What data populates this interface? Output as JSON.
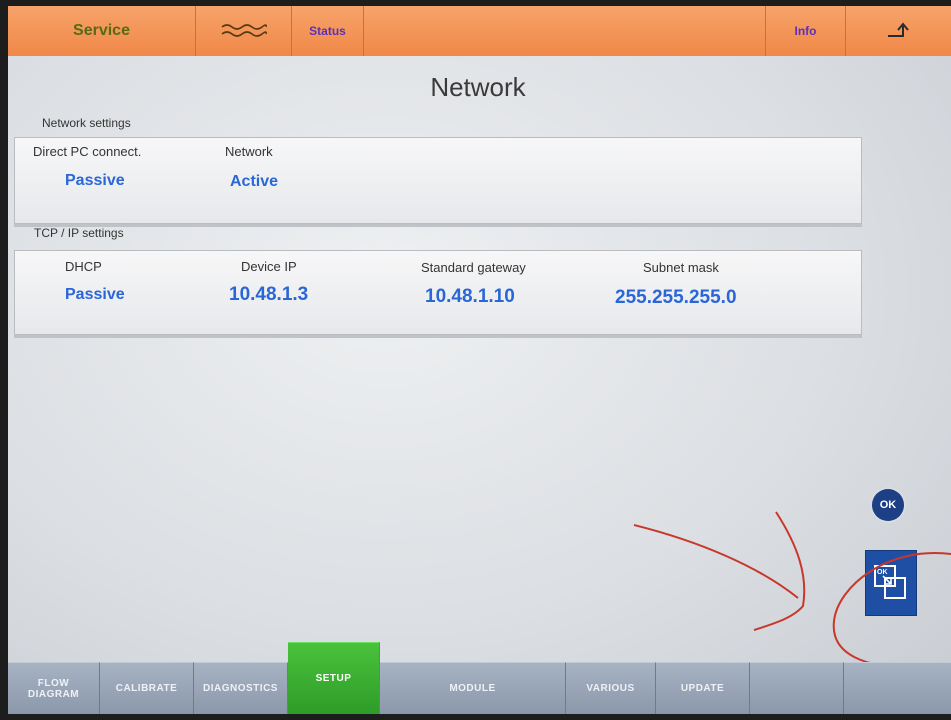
{
  "header": {
    "service_label": "Service",
    "status_label": "Status",
    "info_label": "Info",
    "waves_icon": "waves-icon",
    "back_icon": "return-arrow-icon"
  },
  "page": {
    "title": "Network"
  },
  "network_settings": {
    "section_label": "Network settings",
    "direct_pc": {
      "label": "Direct PC connect.",
      "value": "Passive"
    },
    "network": {
      "label": "Network",
      "value": "Active"
    }
  },
  "tcp_settings": {
    "section_label": "TCP / IP settings",
    "dhcp": {
      "label": "DHCP",
      "value": "Passive"
    },
    "device_ip": {
      "label": "Device IP",
      "value": "10.48.1.3"
    },
    "gateway": {
      "label": "Standard gateway",
      "value": "10.48.1.10"
    },
    "subnet": {
      "label": "Subnet mask",
      "value": "255.255.255.0"
    }
  },
  "actions": {
    "ok_label": "OK",
    "window_icon": "ok-window-icon",
    "window_mini_label": "OK"
  },
  "bottom_tabs": [
    {
      "label_line1": "FLOW",
      "label_line2": "DIAGRAM"
    },
    {
      "label": "CALIBRATE"
    },
    {
      "label": "DIAGNOSTICS"
    },
    {
      "label": "SETUP"
    },
    {
      "label": "MODULE"
    },
    {
      "label": "VARIOUS"
    },
    {
      "label": "UPDATE"
    },
    {
      "label": ""
    },
    {
      "label": ""
    }
  ],
  "colors": {
    "top_bar": "#f08848",
    "value_text": "#2a66d6",
    "active_tab": "#3fb334",
    "inactive_tab": "#98a4b6",
    "ok_button": "#1d3f86",
    "annotation_stroke": "#c8372a"
  }
}
